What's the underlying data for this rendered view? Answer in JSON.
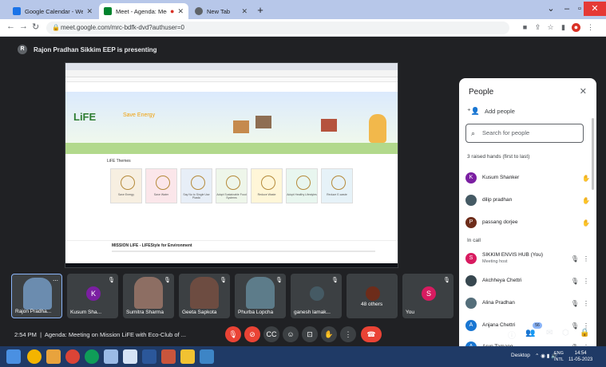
{
  "browser": {
    "tabs": [
      {
        "title": "Google Calendar - Week of Ma",
        "favicon_color": "#1a73e8"
      },
      {
        "title": "Meet - Agenda: Meeting on",
        "favicon_color": "#00832d"
      },
      {
        "title": "New Tab",
        "favicon_color": "#5f6368"
      }
    ],
    "url": "meet.google.com/mrc-bdfk-dvd?authuser=0"
  },
  "presenter": {
    "initial": "R",
    "label": "Rajon Pradhan Sikkim EEP is presenting"
  },
  "shared_screen": {
    "hero_logo": "LiFE",
    "hero_tag": "Save Energy",
    "themes_title": "LiFE Themes",
    "themes": [
      "Save Energy",
      "Save Water",
      "Say No to Single Use Plastic",
      "Adopt Sustainable Food Systems",
      "Reduce Waste",
      "Adopt Healthy Lifestyles",
      "Reduce E-waste"
    ],
    "mission_title": "MISSION LIFE - LIFEStyle for Environment"
  },
  "people_panel": {
    "title": "People",
    "add_people": "Add people",
    "search_placeholder": "Search for people",
    "raised_hands_label": "3 raised hands (first to last)",
    "in_call_label": "In call",
    "raised": [
      {
        "initial": "K",
        "name": "Kusum Shanker",
        "color": "#7b1fa2"
      },
      {
        "initial": "",
        "name": "dilip pradhan",
        "color": "#455a64"
      },
      {
        "initial": "P",
        "name": "passang dorjee",
        "color": "#6d2c1a"
      }
    ],
    "in_call": [
      {
        "initial": "S",
        "name": "SIKKIM ENVIS HUB (You)",
        "sub": "Meeting host",
        "color": "#d81b60"
      },
      {
        "initial": "",
        "name": "Akchheya Chettri",
        "sub": "",
        "color": "#37474f"
      },
      {
        "initial": "",
        "name": "Alina Pradhan",
        "sub": "",
        "color": "#546e7a"
      },
      {
        "initial": "A",
        "name": "Anjana Chettri",
        "sub": "",
        "color": "#1976d2"
      },
      {
        "initial": "A",
        "name": "Arun Tamang",
        "sub": "",
        "color": "#1976d2"
      }
    ]
  },
  "tiles": [
    {
      "name": "Rajon Pradha...",
      "initial": "",
      "color": "#6b8caf"
    },
    {
      "name": "Kusum Sha...",
      "initial": "K",
      "color": "#7b1fa2"
    },
    {
      "name": "Sumitra Sharma",
      "initial": "",
      "color": "#8d6e63"
    },
    {
      "name": "Geeta Sapkota",
      "initial": "",
      "color": "#6d4c41"
    },
    {
      "name": "Phurba Lopcha",
      "initial": "",
      "color": "#5d7c8a"
    },
    {
      "name": "ganesh lamak...",
      "initial": "",
      "color": "#455a64"
    },
    {
      "name": "48 others",
      "initial": "",
      "color": "#3c4043"
    },
    {
      "name": "You",
      "initial": "S",
      "color": "#d81b60"
    }
  ],
  "meeting": {
    "time": "2:54 PM",
    "title": "Agenda: Meeting on Mission LiFE with Eco-Club of ...",
    "people_count": "56"
  },
  "taskbar": {
    "desktop": "Desktop",
    "lang": "ENG",
    "region": "INTL",
    "clock": "14:54",
    "date": "11-05-2023"
  }
}
